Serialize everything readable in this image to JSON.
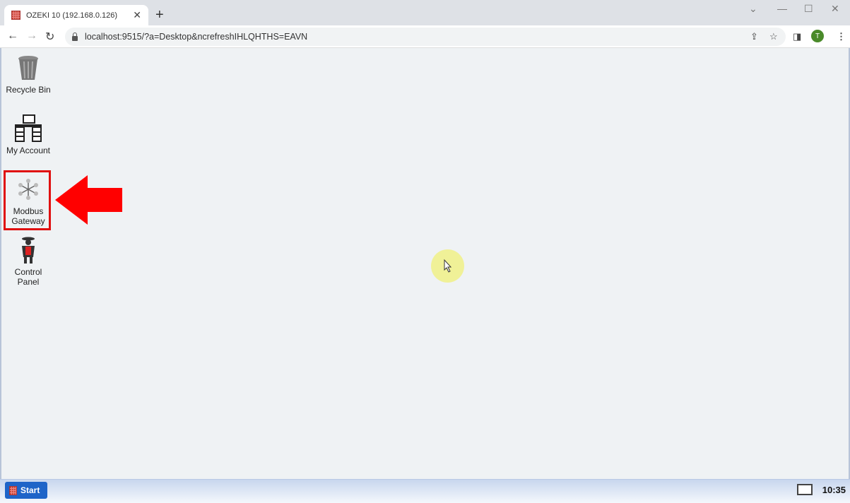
{
  "browser": {
    "tab_title": "OZEKI 10 (192.168.0.126)",
    "url": "localhost:9515/?a=Desktop&ncrefreshIHLQHTHS=EAVN",
    "profile_initial": "T"
  },
  "desktop": {
    "icons": [
      {
        "label": "Recycle Bin",
        "icon": "recycle-bin-icon"
      },
      {
        "label": "My Account",
        "icon": "desk-icon"
      },
      {
        "label": "Modbus Gateway",
        "icon": "modbus-network-icon"
      },
      {
        "label": "Control Panel",
        "icon": "control-panel-icon"
      }
    ],
    "highlight_color": "#e01010"
  },
  "taskbar": {
    "start_label": "Start",
    "clock": "10:35"
  }
}
